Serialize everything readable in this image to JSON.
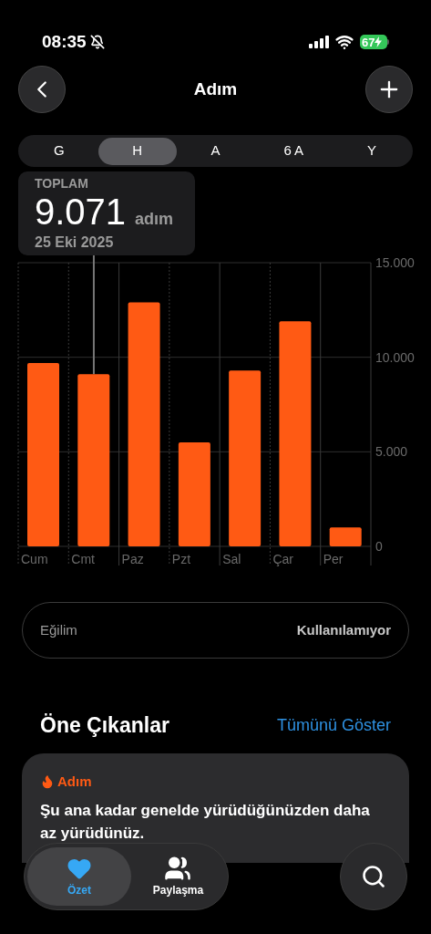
{
  "status_bar": {
    "time": "08:35",
    "silent": true,
    "battery": "67",
    "charging": true
  },
  "nav": {
    "title": "Adım"
  },
  "ranges": [
    {
      "label": "G",
      "selected": false
    },
    {
      "label": "H",
      "selected": true
    },
    {
      "label": "A",
      "selected": false
    },
    {
      "label": "6 A",
      "selected": false
    },
    {
      "label": "Y",
      "selected": false
    }
  ],
  "summary": {
    "label": "TOPLAM",
    "value": "9.071",
    "unit": "adım",
    "date": "25 Eki 2025"
  },
  "chart": {
    "selected": [
      false,
      true,
      false,
      false,
      false,
      false,
      false
    ],
    "chart_data": {
      "type": "bar",
      "categories": [
        "Cum",
        "Cmt",
        "Paz",
        "Pzt",
        "Sal",
        "Çar",
        "Per"
      ],
      "series": [
        {
          "color": "#ff5a14",
          "values": [
            9700,
            9100,
            12900,
            5500,
            9300,
            11900,
            1000
          ]
        }
      ],
      "ylim": [
        0,
        15000
      ],
      "yticks": [
        {
          "value": 0,
          "label": "0"
        },
        {
          "value": 5000,
          "label": "5.000"
        },
        {
          "value": 10000,
          "label": "10.000"
        },
        {
          "value": 15000,
          "label": "15.000"
        }
      ]
    }
  },
  "trend": {
    "label": "Eğilim",
    "value": "Kullanılamıyor"
  },
  "highlights": {
    "title": "Öne Çıkanlar",
    "action": "Tümünü Göster",
    "card": {
      "category": "Adım",
      "text": "Şu ana kadar genelde yürüdüğünüzden daha az yürüdünüz."
    }
  },
  "tab_bar": {
    "tabs": [
      {
        "label": "Özet",
        "kind": "heart",
        "selected": true
      },
      {
        "label": "Paylaşma",
        "kind": "people",
        "selected": false
      }
    ]
  }
}
